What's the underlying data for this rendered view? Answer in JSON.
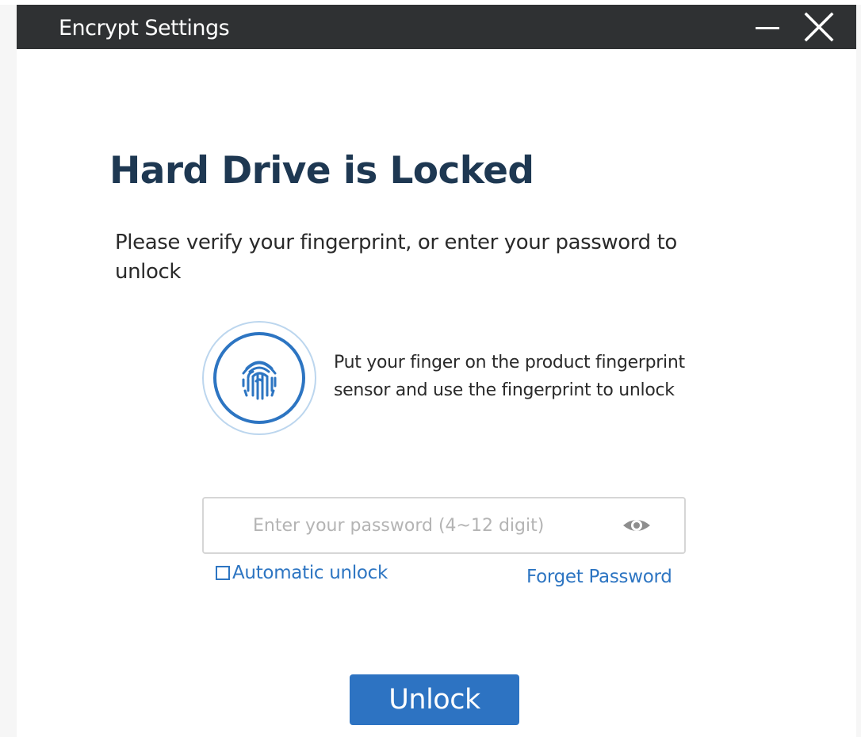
{
  "window": {
    "title": "Encrypt Settings",
    "minimize_icon": "minimize-icon",
    "close_icon": "close-icon"
  },
  "main": {
    "heading": "Hard Drive is Locked",
    "subtext": "Please verify your fingerprint, or enter your password to unlock",
    "fingerprint": {
      "icon": "fingerprint-icon",
      "instructions": "Put your finger on the product fingerprint sensor and use the fingerprint to unlock"
    },
    "password": {
      "value": "",
      "placeholder": "Enter your password (4~12 digit)",
      "show_icon": "eye-icon"
    },
    "auto_unlock": {
      "label": "Automatic unlock",
      "checked": false
    },
    "forget_password": "Forget Password",
    "unlock_button": "Unlock"
  },
  "colors": {
    "titlebar": "#2f3133",
    "heading": "#1e3852",
    "accent": "#2d75c2",
    "ring_light": "#bcd6ee"
  }
}
